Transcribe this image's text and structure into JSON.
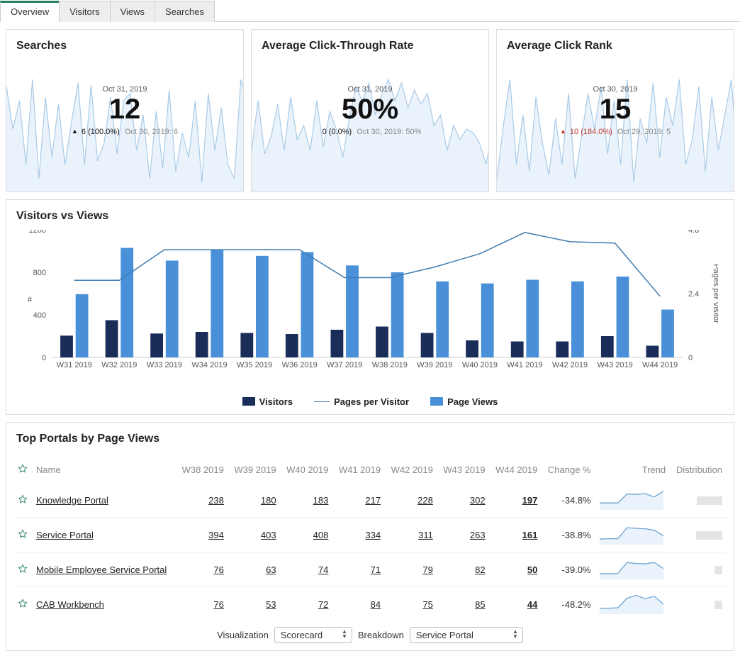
{
  "tabs": [
    "Overview",
    "Visitors",
    "Views",
    "Searches"
  ],
  "active_tab": 0,
  "cards": [
    {
      "title": "Searches",
      "date": "Oct 31, 2019",
      "value": "12",
      "delta_symbol": "▲",
      "delta_text": "6 (100.0%)",
      "delta_class": "up",
      "ref": "Oct 30, 2019: 6",
      "spark": [
        40,
        100,
        60,
        150,
        30,
        170,
        55,
        140,
        65,
        150,
        90,
        35,
        150,
        38,
        145,
        120,
        55,
        135,
        60,
        50,
        130,
        80,
        170,
        75,
        155,
        45,
        160,
        105,
        140,
        60,
        175,
        50,
        130,
        70,
        150,
        170,
        30,
        60
      ]
    },
    {
      "title": "Average Click-Through Rate",
      "date": "Oct 31, 2019",
      "value": "50%",
      "delta_symbol": "",
      "delta_text": "0 (0.0%)",
      "delta_class": "up",
      "ref": "Oct 30, 2019: 50%",
      "spark": [
        130,
        60,
        135,
        110,
        65,
        130,
        55,
        115,
        95,
        130,
        60,
        125,
        75,
        100,
        140,
        85,
        40,
        60,
        35,
        80,
        50,
        30,
        60,
        35,
        70,
        45,
        65,
        50,
        95,
        80,
        130,
        95,
        115,
        100,
        105,
        120,
        150,
        100
      ]
    },
    {
      "title": "Average Click Rank",
      "date": "Oct 30, 2019",
      "value": "15",
      "delta_symbol": "▲",
      "delta_text": "10 (184.0%)",
      "delta_class": "upbad",
      "ref": "Oct 29, 2019: 5",
      "spark": [
        170,
        95,
        30,
        150,
        80,
        160,
        55,
        120,
        165,
        85,
        150,
        50,
        170,
        110,
        50,
        100,
        40,
        135,
        60,
        150,
        30,
        175,
        85,
        120,
        35,
        140,
        55,
        95,
        30,
        150,
        115,
        40,
        160,
        55,
        130,
        80,
        30,
        150
      ]
    }
  ],
  "chart_data": {
    "type": "bar",
    "title": "Visitors vs Views",
    "categories": [
      "W31 2019",
      "W32 2019",
      "W33 2019",
      "W34 2019",
      "W35 2019",
      "W36 2019",
      "W37 2019",
      "W38 2019",
      "W39 2019",
      "W40 2019",
      "W41 2019",
      "W42 2019",
      "W43 2019",
      "W44 2019"
    ],
    "series": [
      {
        "name": "Visitors",
        "color": "#1a2c58",
        "values": [
          205,
          350,
          225,
          240,
          230,
          220,
          260,
          290,
          230,
          160,
          150,
          150,
          200,
          110
        ]
      },
      {
        "name": "Page Views",
        "color": "#4a90d9",
        "values": [
          595,
          1030,
          910,
          1010,
          955,
          990,
          865,
          800,
          715,
          695,
          730,
          715,
          760,
          450
        ]
      },
      {
        "name": "Pages per Visitor",
        "color": "#3e7cb1",
        "type": "line",
        "axis": "right",
        "values": [
          2.9,
          2.9,
          4.05,
          4.05,
          4.05,
          4.05,
          3.0,
          3.0,
          3.4,
          3.9,
          4.7,
          4.35,
          4.3,
          2.3
        ]
      }
    ],
    "ylim_left": [
      0,
      1200
    ],
    "yticks_left": [
      0,
      400,
      800,
      1200
    ],
    "ylim_right": [
      0,
      4.8
    ],
    "yticks_right": [
      0,
      2.4,
      4.8
    ],
    "ylabel_left": "#",
    "ylabel_right": "Pages per Visitor",
    "legend": [
      "Visitors",
      "Pages per Visitor",
      "Page Views"
    ]
  },
  "table": {
    "title": "Top Portals by Page Views",
    "headers": [
      "Name",
      "W38 2019",
      "W39 2019",
      "W40 2019",
      "W41 2019",
      "W42 2019",
      "W43 2019",
      "W44 2019",
      "Change %",
      "Trend",
      "Distribution"
    ],
    "rows": [
      {
        "name": "Knowledge Portal",
        "vals": [
          238,
          180,
          183,
          217,
          228,
          302,
          197
        ],
        "change": "-34.8%",
        "trend": [
          0.35,
          0.35,
          0.35,
          0.8,
          0.78,
          0.82,
          0.65,
          0.95
        ],
        "dist": 0.46
      },
      {
        "name": "Service Portal",
        "vals": [
          394,
          403,
          408,
          334,
          311,
          263,
          161
        ],
        "change": "-38.8%",
        "trend": [
          0.28,
          0.3,
          0.3,
          0.85,
          0.82,
          0.8,
          0.72,
          0.45
        ],
        "dist": 0.48
      },
      {
        "name": "Mobile Employee Service Portal",
        "vals": [
          76,
          63,
          74,
          71,
          79,
          82,
          50
        ],
        "change": "-39.0%",
        "trend": [
          0.3,
          0.28,
          0.3,
          0.85,
          0.8,
          0.78,
          0.85,
          0.55
        ],
        "dist": 0.14
      },
      {
        "name": "CAB Workbench",
        "vals": [
          76,
          53,
          72,
          84,
          75,
          85,
          44
        ],
        "change": "-48.2%",
        "trend": [
          0.3,
          0.3,
          0.32,
          0.8,
          0.95,
          0.78,
          0.9,
          0.5
        ],
        "dist": 0.14
      }
    ]
  },
  "controls": {
    "visualization_label": "Visualization",
    "visualization_value": "Scorecard",
    "breakdown_label": "Breakdown",
    "breakdown_value": "Service Portal"
  }
}
